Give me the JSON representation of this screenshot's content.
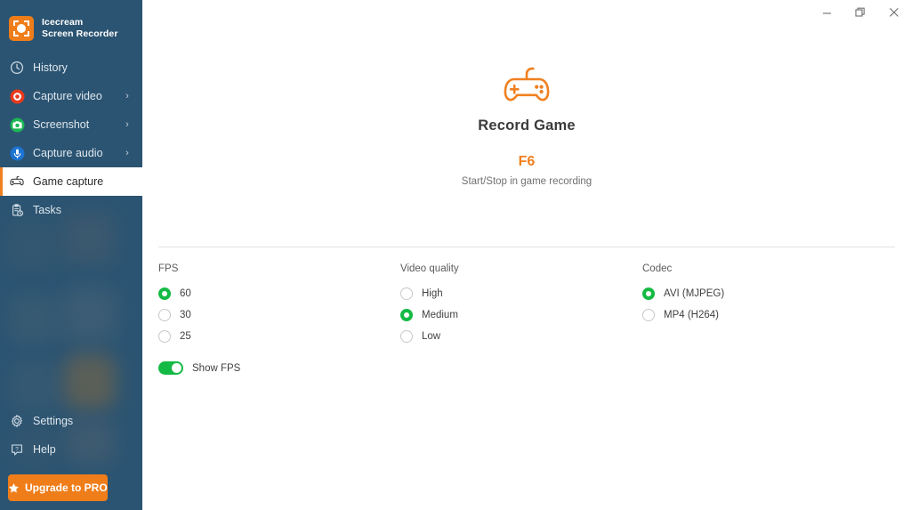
{
  "app": {
    "name_line1": "Icecream",
    "name_line2": "Screen Recorder",
    "logo_icon": "icecream-logo-icon",
    "accent_orange": "#ef7d1a",
    "sidebar_bg": "#2b5472",
    "green": "#15ba44"
  },
  "titlebar": {
    "minimize_label": "—",
    "restore_label": "❐",
    "close_label": "✕"
  },
  "sidebar": {
    "items": [
      {
        "label": "History",
        "icon": "clock-icon",
        "chevron": "",
        "active": false
      },
      {
        "label": "Capture video",
        "icon": "record-icon",
        "chevron": "›",
        "active": false
      },
      {
        "label": "Screenshot",
        "icon": "camera-icon",
        "chevron": "›",
        "active": false
      },
      {
        "label": "Capture audio",
        "icon": "microphone-icon",
        "chevron": "›",
        "active": false
      },
      {
        "label": "Game capture",
        "icon": "gamepad-icon",
        "chevron": "",
        "active": true
      },
      {
        "label": "Tasks",
        "icon": "tasks-icon",
        "chevron": "",
        "active": false
      }
    ],
    "bottom_items": [
      {
        "label": "Settings",
        "icon": "gear-icon"
      },
      {
        "label": "Help",
        "icon": "help-icon"
      }
    ],
    "upgrade_label": "Upgrade to PRO",
    "upgrade_icon": "star-icon"
  },
  "hero": {
    "icon": "gamepad-outline-icon",
    "title": "Record Game",
    "shortcut": "F6",
    "subtitle": "Start/Stop in game recording"
  },
  "options": {
    "fps": {
      "title": "FPS",
      "items": [
        {
          "label": "60",
          "selected": true
        },
        {
          "label": "30",
          "selected": false
        },
        {
          "label": "25",
          "selected": false
        }
      ],
      "toggle": {
        "label": "Show FPS",
        "on": true
      }
    },
    "video_quality": {
      "title": "Video quality",
      "items": [
        {
          "label": "High",
          "selected": false
        },
        {
          "label": "Medium",
          "selected": true
        },
        {
          "label": "Low",
          "selected": false
        }
      ]
    },
    "codec": {
      "title": "Codec",
      "items": [
        {
          "label": "AVI (MJPEG)",
          "selected": true
        },
        {
          "label": "MP4 (H264)",
          "selected": false
        }
      ]
    }
  }
}
